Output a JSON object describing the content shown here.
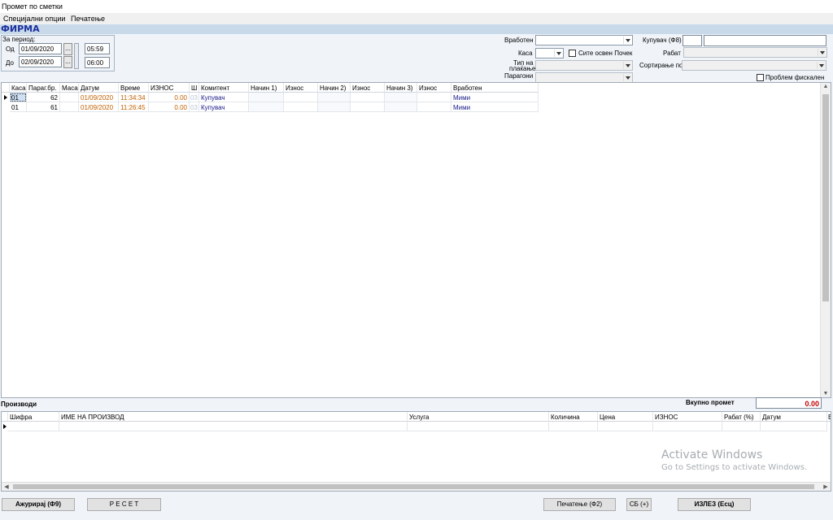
{
  "window": {
    "title": "Промет по сметки"
  },
  "menu": [
    "Специјални опции",
    "Печатење"
  ],
  "firma_label": "ФИРМА",
  "period": {
    "label": "За период:",
    "from_label": "Од",
    "from_date": "01/09/2020",
    "from_time": "05:59",
    "to_label": "До",
    "to_date": "02/09/2020",
    "to_time": "06:00",
    "picker": "..."
  },
  "filters": {
    "vraboten_label": "Вработен",
    "kasa_label": "Каса",
    "site_osven_label": "Сите освен Почек",
    "tip_label_line1": "Тип на",
    "tip_label_line2": "плаќање",
    "paragoni_label": "Парагони",
    "kupuvac_label": "Купувач (Ф8)",
    "rabat_label": "Рабат",
    "sortiranje_label": "Сортирање по",
    "problem_label": "Проблем фискален"
  },
  "receipts": {
    "columns": [
      "Каса",
      "Параг.бр.",
      "Маса",
      "Датум",
      "Време",
      "ИЗНОС",
      "Ш",
      "Комитент",
      "Начин 1)",
      "Износ",
      "Начин 2)",
      "Износ",
      "Начин 3)",
      "Износ",
      "Вработен"
    ],
    "rows": [
      {
        "kasa": "01",
        "parag": "62",
        "masa": "",
        "datum": "01/09/2020",
        "vreme": "11:34:34",
        "iznos": "0.00",
        "sh": "03",
        "komitent": "Купувач",
        "vraboten": "Мими"
      },
      {
        "kasa": "01",
        "parag": "61",
        "masa": "",
        "datum": "01/09/2020",
        "vreme": "11:26:45",
        "iznos": "0.00",
        "sh": "03",
        "komitent": "Купувач",
        "vraboten": "Мими"
      }
    ]
  },
  "products": {
    "label": "Производи",
    "total_label": "Вкупно промет",
    "total_value": "0.00",
    "columns": [
      "Шифра",
      "ИМЕ НА ПРОИЗВОД",
      "Услуга",
      "Количина",
      "Цена",
      "ИЗНОС",
      "Рабат (%)",
      "Датум",
      "В"
    ]
  },
  "buttons": {
    "update": "Ажурирај (Ф9)",
    "reset": "Р Е С Е Т",
    "print": "Печатење (Ф2)",
    "sb": "СБ (+)",
    "exit": "ИЗЛЕЗ (Есц)"
  },
  "watermark": {
    "line1": "Activate Windows",
    "line2": "Go to Settings to activate Windows."
  },
  "colors": {
    "firma_bar": "#c8d9ea",
    "firma_text": "#1a2f9c",
    "total_value": "#c00000"
  }
}
